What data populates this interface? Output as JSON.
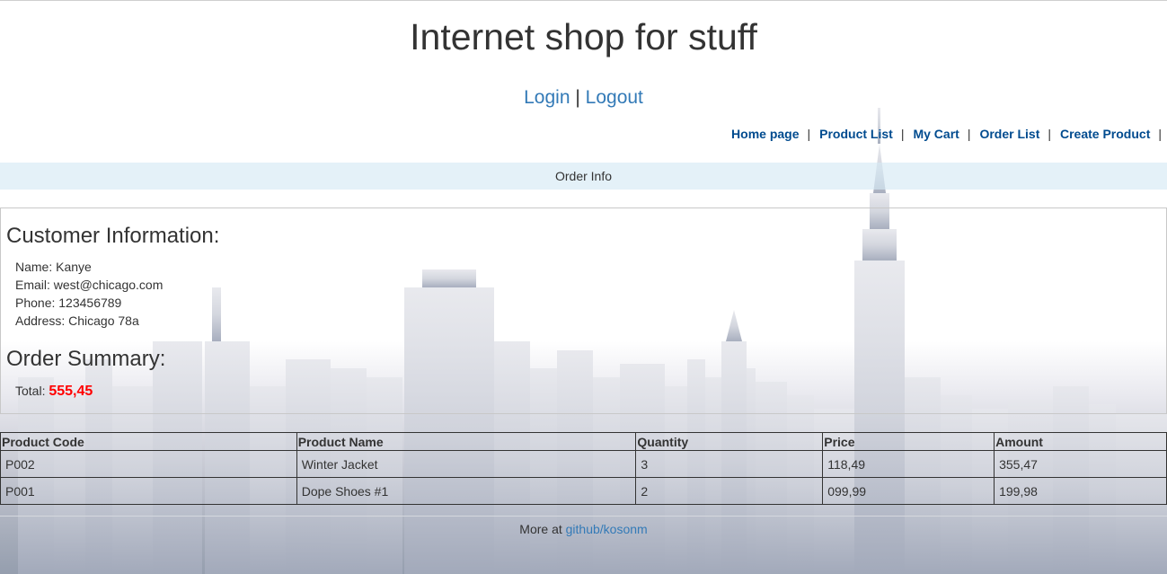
{
  "header": {
    "title": "Internet shop for stuff",
    "login_label": "Login",
    "separator": "|",
    "logout_label": "Logout"
  },
  "menu": {
    "items": [
      {
        "label": "Home page"
      },
      {
        "label": "Product List"
      },
      {
        "label": "My Cart"
      },
      {
        "label": "Order List"
      },
      {
        "label": "Create Product"
      }
    ],
    "separator": "|"
  },
  "page": {
    "title": "Order Info"
  },
  "customer": {
    "heading": "Customer Information:",
    "name": "Name: Kanye",
    "email": "Email: west@chicago.com",
    "phone": "Phone: 123456789",
    "address": "Address: Chicago 78a"
  },
  "summary": {
    "heading": "Order Summary:",
    "total_label": "Total:",
    "total_value": "555,45",
    "total_color": "#ff0000"
  },
  "table": {
    "headers": [
      "Product Code",
      "Product Name",
      "Quantity",
      "Price",
      "Amount"
    ],
    "rows": [
      [
        "P002",
        "Winter Jacket",
        "3",
        "118,49",
        "355,47"
      ],
      [
        "P001",
        "Dope Shoes #1",
        "2",
        "099,99",
        "199,98"
      ]
    ]
  },
  "footer": {
    "prefix": "More at",
    "link_label": "github/kosonm"
  },
  "colors": {
    "link": "#337ab7",
    "menu_link": "#004b8f",
    "banner": "#d6e9f5"
  }
}
